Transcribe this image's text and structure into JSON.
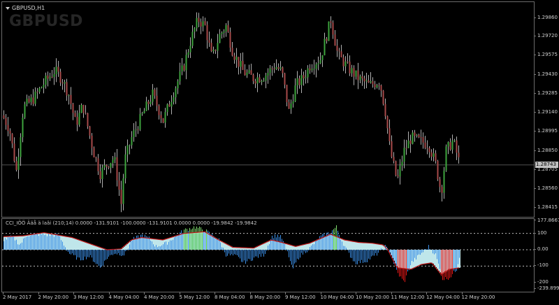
{
  "chart": {
    "symbol_label": "GBPUSD,H1",
    "watermark": "GBPUSD",
    "current_price": "1.28743",
    "colors": {
      "background": "#000000",
      "grid": "#606060",
      "bull_candle": "#3ea43e",
      "bear_candle": "#a84a4a",
      "wick": "#b0b0b0"
    },
    "price_axis": {
      "labels": [
        "1.29860",
        "1.29720",
        "1.29575",
        "1.29430",
        "1.29285",
        "1.29140",
        "1.28995",
        "1.28850",
        "1.28705",
        "1.28560",
        "1.28415"
      ]
    },
    "price_series": {
      "ylim": [
        1.2838,
        1.2995
      ],
      "anchors": [
        [
          0,
          1.2912
        ],
        [
          10,
          1.2902
        ],
        [
          20,
          1.287
        ],
        [
          30,
          1.2918
        ],
        [
          45,
          1.2925
        ],
        [
          60,
          1.2937
        ],
        [
          75,
          1.2946
        ],
        [
          85,
          1.294
        ],
        [
          95,
          1.2928
        ],
        [
          105,
          1.2905
        ],
        [
          115,
          1.292
        ],
        [
          130,
          1.2885
        ],
        [
          140,
          1.2868
        ],
        [
          150,
          1.2875
        ],
        [
          160,
          1.288
        ],
        [
          170,
          1.2845
        ],
        [
          175,
          1.2878
        ],
        [
          185,
          1.2895
        ],
        [
          200,
          1.2912
        ],
        [
          215,
          1.2928
        ],
        [
          230,
          1.2908
        ],
        [
          245,
          1.293
        ],
        [
          260,
          1.295
        ],
        [
          270,
          1.297
        ],
        [
          280,
          1.2985
        ],
        [
          290,
          1.298
        ],
        [
          300,
          1.2955
        ],
        [
          310,
          1.2972
        ],
        [
          320,
          1.298
        ],
        [
          330,
          1.296
        ],
        [
          345,
          1.2945
        ],
        [
          360,
          1.294
        ],
        [
          375,
          1.2942
        ],
        [
          390,
          1.295
        ],
        [
          400,
          1.2945
        ],
        [
          410,
          1.2915
        ],
        [
          420,
          1.2935
        ],
        [
          430,
          1.294
        ],
        [
          440,
          1.295
        ],
        [
          455,
          1.2955
        ],
        [
          470,
          1.2985
        ],
        [
          480,
          1.2958
        ],
        [
          495,
          1.2948
        ],
        [
          510,
          1.294
        ],
        [
          525,
          1.2935
        ],
        [
          540,
          1.2938
        ],
        [
          548,
          1.2915
        ],
        [
          555,
          1.2885
        ],
        [
          565,
          1.2862
        ],
        [
          575,
          1.2885
        ],
        [
          585,
          1.2895
        ],
        [
          600,
          1.2892
        ],
        [
          610,
          1.289
        ],
        [
          620,
          1.2875
        ],
        [
          628,
          1.2853
        ],
        [
          635,
          1.2885
        ],
        [
          645,
          1.2893
        ],
        [
          655,
          1.2874
        ]
      ]
    },
    "indicator": {
      "title": "CCI_IÖÖ Ääå ä laâi (210;14) 0.0000 -131.9101 -100.0000 -131.9101 0.0000 0.0000 -19.9842 -19.9842",
      "ylim": [
        -240,
        180
      ],
      "axis_labels": [
        "177.8667",
        "100",
        "0.00",
        "-100",
        "-200",
        "-239.8990"
      ],
      "colors": {
        "blue": "#3a8ee6",
        "light": "#bfe6ea",
        "green": "#44c444",
        "red": "#e81818",
        "line": "#c01818"
      },
      "cci_anchors": [
        [
          0,
          60
        ],
        [
          15,
          80
        ],
        [
          25,
          30
        ],
        [
          35,
          90
        ],
        [
          50,
          95
        ],
        [
          65,
          90
        ],
        [
          80,
          90
        ],
        [
          95,
          -20
        ],
        [
          110,
          -60
        ],
        [
          125,
          -40
        ],
        [
          140,
          -110
        ],
        [
          150,
          -50
        ],
        [
          160,
          -20
        ],
        [
          175,
          -30
        ],
        [
          185,
          60
        ],
        [
          200,
          90
        ],
        [
          210,
          70
        ],
        [
          220,
          20
        ],
        [
          235,
          40
        ],
        [
          250,
          90
        ],
        [
          260,
          120
        ],
        [
          275,
          140
        ],
        [
          290,
          120
        ],
        [
          300,
          90
        ],
        [
          310,
          60
        ],
        [
          320,
          -30
        ],
        [
          335,
          -40
        ],
        [
          345,
          -80
        ],
        [
          360,
          -50
        ],
        [
          375,
          -30
        ],
        [
          385,
          80
        ],
        [
          395,
          90
        ],
        [
          400,
          70
        ],
        [
          410,
          -40
        ],
        [
          415,
          -120
        ],
        [
          425,
          -40
        ],
        [
          440,
          10
        ],
        [
          455,
          80
        ],
        [
          470,
          110
        ],
        [
          478,
          140
        ],
        [
          485,
          60
        ],
        [
          495,
          -20
        ],
        [
          505,
          -80
        ],
        [
          520,
          -70
        ],
        [
          535,
          -30
        ],
        [
          548,
          20
        ],
        [
          555,
          -20
        ],
        [
          565,
          -140
        ],
        [
          575,
          -200
        ],
        [
          585,
          -80
        ],
        [
          600,
          -20
        ],
        [
          610,
          20
        ],
        [
          620,
          -30
        ],
        [
          630,
          -180
        ],
        [
          640,
          -170
        ],
        [
          650,
          -120
        ],
        [
          655,
          -20
        ]
      ],
      "line_anchors": [
        [
          0,
          80
        ],
        [
          30,
          85
        ],
        [
          60,
          105
        ],
        [
          100,
          75
        ],
        [
          130,
          30
        ],
        [
          150,
          0
        ],
        [
          170,
          5
        ],
        [
          185,
          60
        ],
        [
          200,
          75
        ],
        [
          230,
          60
        ],
        [
          260,
          100
        ],
        [
          290,
          110
        ],
        [
          310,
          60
        ],
        [
          330,
          15
        ],
        [
          360,
          10
        ],
        [
          385,
          60
        ],
        [
          400,
          45
        ],
        [
          420,
          20
        ],
        [
          440,
          40
        ],
        [
          470,
          95
        ],
        [
          490,
          60
        ],
        [
          510,
          45
        ],
        [
          530,
          40
        ],
        [
          545,
          30
        ],
        [
          552,
          0
        ],
        [
          565,
          -110
        ],
        [
          585,
          -120
        ],
        [
          600,
          -90
        ],
        [
          615,
          -80
        ],
        [
          628,
          -150
        ],
        [
          640,
          -120
        ],
        [
          655,
          -110
        ]
      ]
    },
    "time_axis": {
      "labels": [
        "2 May 2017",
        "2 May 20:00",
        "3 May 12:00",
        "4 May 04:00",
        "4 May 20:00",
        "5 May 12:00",
        "8 May 04:00",
        "8 May 20:00",
        "9 May 12:00",
        "10 May 04:00",
        "10 May 20:00",
        "11 May 12:00",
        "12 May 04:00",
        "12 May 20:00"
      ]
    }
  }
}
